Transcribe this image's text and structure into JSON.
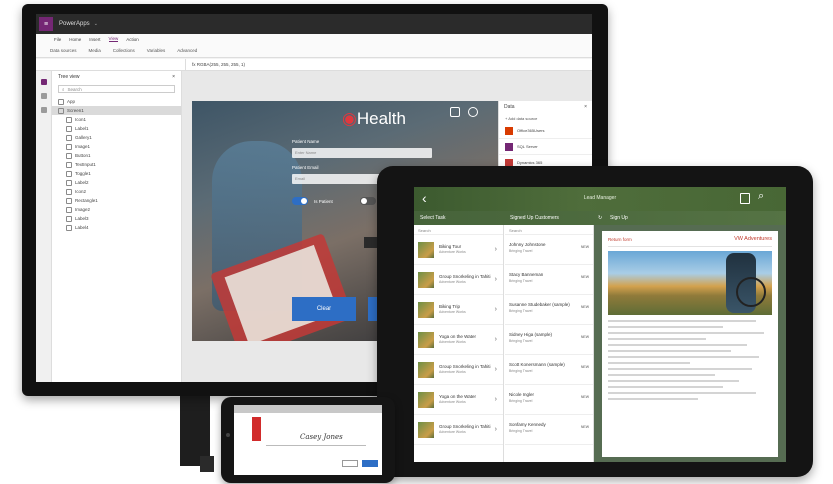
{
  "monitor": {
    "app_title": "PowerApps",
    "menu": [
      "File",
      "Home",
      "Insert",
      "View",
      "Action"
    ],
    "ribbon": [
      "Data sources",
      "Media",
      "Collections",
      "Variables",
      "Advanced"
    ],
    "formula": "fx  RGBA(255, 255, 255, 1)",
    "treeview": {
      "title": "Tree view",
      "search_placeholder": "Search",
      "items": [
        "App",
        "Screen1",
        "Icon1",
        "Label1",
        "Gallery1",
        "Image1",
        "Button1",
        "TextInput1",
        "Toggle1",
        "Label2",
        "Icon2",
        "Rectangle1",
        "Image2",
        "Label3",
        "Label4"
      ]
    },
    "preview": {
      "brand_plain": "Health",
      "field1_label": "Patient Name",
      "field1_placeholder": "Enter Name",
      "field2_label": "Patient Email",
      "field2_placeholder": "Email",
      "toggle1_label": "Is Patient",
      "toggle2_label": "Fo",
      "scan_label": "Scan",
      "clear_button": "Clear"
    },
    "data_panel": {
      "title": "Data",
      "add_label": "+ Add data source",
      "sources": [
        "Office365Users",
        "SQL Server",
        "Dynamics 365"
      ]
    }
  },
  "tablet": {
    "title": "Lead Manager",
    "select_task": "Select Task",
    "col2_header": "Signed Up Customers",
    "col3_header": "Sign Up",
    "search_placeholder": "Search",
    "tasks": [
      {
        "name": "Biking Tour",
        "sub": "Adventure Works"
      },
      {
        "name": "Group Snorkeling in Tahiti",
        "sub": "Adventure Works"
      },
      {
        "name": "Biking Trip",
        "sub": "Adventure Works"
      },
      {
        "name": "Yoga on the Water",
        "sub": "Adventure Works"
      },
      {
        "name": "Group Snorkeling in Tahiti",
        "sub": "Adventure Works"
      },
      {
        "name": "Yoga on the Water",
        "sub": "Adventure Works"
      },
      {
        "name": "Group Snorkeling in Tahiti",
        "sub": "Adventure Works"
      }
    ],
    "customers": [
      {
        "name": "Johnny Johnstone",
        "sub": "Bringing Travel",
        "tag": "NEW"
      },
      {
        "name": "Stacy Banneman",
        "sub": "Bringing Travel",
        "tag": "NEW"
      },
      {
        "name": "Susanne Studebaker (sample)",
        "sub": "Bringing Travel",
        "tag": "NEW"
      },
      {
        "name": "Sidney Higa (sample)",
        "sub": "Bringing Travel",
        "tag": "NEW"
      },
      {
        "name": "Scott Konersmann (sample)",
        "sub": "Bringing Travel",
        "tag": "NEW"
      },
      {
        "name": "Nicole Ingler",
        "sub": "Bringing Travel",
        "tag": "NEW"
      },
      {
        "name": "Sonfamy Kennedy",
        "sub": "Bringing Travel",
        "tag": "NEW"
      }
    ],
    "doc": {
      "left_title": "Return form",
      "right_title": "VW Adventures"
    }
  },
  "phone": {
    "signature": "Casey Jones"
  },
  "colors": {
    "powerapps_purple": "#742774",
    "button_blue": "#2d6ec5",
    "brand_red": "#e0383e",
    "tablet_green": "#4f6d3b"
  }
}
